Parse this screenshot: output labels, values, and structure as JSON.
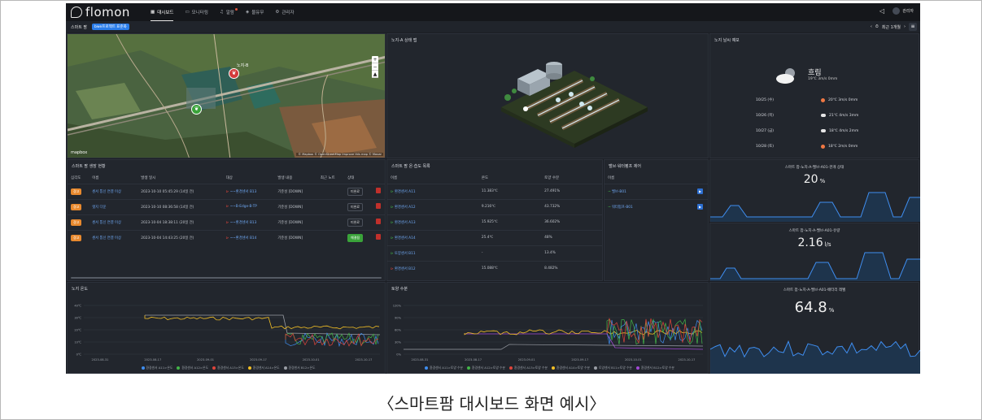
{
  "app": {
    "brand": "flomon",
    "page": "스마트 팜",
    "subtitle": "〈스마트팜 대시보드 화면 예시〉"
  },
  "nav": [
    {
      "label": "대시보드",
      "icon": "grid-icon"
    },
    {
      "label": "모니터링",
      "icon": "monitor-icon"
    },
    {
      "label": "알람",
      "icon": "bell-icon"
    },
    {
      "label": "물유무",
      "icon": "drop-icon"
    },
    {
      "label": "관리자",
      "icon": "settings-icon"
    }
  ],
  "user": {
    "name": "관리자"
  },
  "subbar": {
    "badge": "bwe프로젝트 표준화",
    "range": "최근 1개월"
  },
  "map": {
    "node_label": "노지-B",
    "attribution": "© Mapbox © OpenStreetMap Improve this map © Maxar",
    "logo": "mapbox"
  },
  "farm": {
    "title": "노지-A 상태 맵"
  },
  "weather": {
    "title": "노지 날씨 예보",
    "today": {
      "condition": "흐림",
      "detail": "19℃  3m/s  0mm"
    },
    "forecast": [
      {
        "date": "10/25 (수)",
        "icon": "sun",
        "detail": "20℃  3m/s  0mm"
      },
      {
        "date": "10/26 (목)",
        "icon": "cloud",
        "detail": "21℃  4m/s  3mm"
      },
      {
        "date": "10/27 (금)",
        "icon": "cloud",
        "detail": "18℃  4m/s  2mm"
      },
      {
        "date": "10/28 (토)",
        "icon": "sun",
        "detail": "18℃  2m/s  0mm"
      }
    ]
  },
  "growth": {
    "title": "스마트 팜 생장 현황",
    "headers": [
      "심각도",
      "이름",
      "발생 일시",
      "대상",
      "발생 내용",
      "최근 노트",
      "상태",
      ""
    ],
    "rows": [
      {
        "severity": "경고",
        "color": "#e8892e",
        "name": "센서 통신 연결 이상",
        "time": "2023-10-10 05:45:29 (14일 전)",
        "target": "~~환경센서 B13",
        "content": "기준성 [DOWN]",
        "note": "",
        "status": "미완료",
        "done": false
      },
      {
        "severity": "경고",
        "color": "#e8892e",
        "name": "엣지 다운",
        "time": "2023-10-10 08:36:58 (14일 전)",
        "target": "~~B-Edge-B-TP",
        "content": "기준성 [DOWN]",
        "note": "",
        "status": "미완료",
        "done": false
      },
      {
        "severity": "경고",
        "color": "#e8892e",
        "name": "센서 통신 연결 이상",
        "time": "2023-10-04 18:38:11 (20일 전)",
        "target": "~~환경센서 B13",
        "content": "기준성 [DOWN]",
        "note": "",
        "status": "미완료",
        "done": false
      },
      {
        "severity": "경고",
        "color": "#e8892e",
        "name": "센서 통신 연결 이상",
        "time": "2023-10-04 14:43:25 (20일 전)",
        "target": "~~환경센서 B14",
        "content": "기준성 [DOWN]",
        "note": "",
        "status": "해결됨",
        "done": true
      }
    ]
  },
  "sensors": {
    "title": "스마트 팜 온·습도 목록",
    "headers": [
      "이름",
      "온도",
      "토양 수분"
    ],
    "rows": [
      {
        "name": "환경센서 A11",
        "temp": "11.383℃",
        "soil": "27.491%"
      },
      {
        "name": "환경센서 A12",
        "temp": "9.216℃",
        "soil": "43.732%"
      },
      {
        "name": "환경센서 A13",
        "temp": "15.925℃",
        "soil": "36.602%"
      },
      {
        "name": "환경센서 A14",
        "temp": "25.4℃",
        "soil": "48%"
      },
      {
        "name": "토양센서 B11",
        "temp": "-",
        "soil": "13.4%"
      },
      {
        "name": "환경센서 B12",
        "temp": "15.088℃",
        "soil": "8.482%"
      }
    ]
  },
  "control": {
    "title": "밸브·워터펌프 제어",
    "header": "이름",
    "items": [
      {
        "name": "밸브-B01"
      },
      {
        "name": "워터펌프-B01"
      }
    ]
  },
  "small1": {
    "title": "스마트 팜-노지-A-밸브-A01-관개 상태",
    "value": "20",
    "unit": "%"
  },
  "small2": {
    "title": "스마트 팜-노지-A-밸브-A01-유량",
    "value": "2.16",
    "unit": "l/s"
  },
  "small3": {
    "title": "스마트 팜-노지-A-밸브-A01-배터리 레벨",
    "value": "64.8",
    "unit": "%"
  },
  "temp_chart": {
    "title": "노지 온도",
    "yticks": [
      "40℃",
      "30℃",
      "20℃",
      "10℃",
      "0℃"
    ],
    "xticks": [
      "2023-08-31",
      "2023-08-17",
      "2023-09-01",
      "2023-09-17",
      "2023-10-01",
      "2023-10-17"
    ],
    "legend": [
      {
        "name": "환경센서 A11>온도",
        "color": "#3f8ef0"
      },
      {
        "name": "환경센서 A12>온도",
        "color": "#43b548"
      },
      {
        "name": "환경센서 A13>온도",
        "color": "#e0443b"
      },
      {
        "name": "환경센서 A14>온도",
        "color": "#f4c025"
      },
      {
        "name": "환경센서 B12>온도",
        "color": "#9a9ea6"
      }
    ]
  },
  "soil_chart": {
    "title": "토양 수분",
    "yticks": [
      "120%",
      "90%",
      "60%",
      "30%",
      "0%"
    ],
    "xticks": [
      "2023-08-31",
      "2023-08-17",
      "2023-09-01",
      "2023-09-17",
      "2023-10-01",
      "2023-10-17"
    ],
    "legend": [
      {
        "name": "환경센서 A11>토양 수분",
        "color": "#3f8ef0"
      },
      {
        "name": "환경센서 A12>토양 수분",
        "color": "#43b548"
      },
      {
        "name": "환경센서 A13>토양 수분",
        "color": "#e0443b"
      },
      {
        "name": "환경센서 A14>토양 수분",
        "color": "#f4c025"
      },
      {
        "name": "토양센서 B11>토양 수분",
        "color": "#9a9ea6"
      },
      {
        "name": "환경센서 B12>토양 수분",
        "color": "#a34ad6"
      }
    ]
  }
}
